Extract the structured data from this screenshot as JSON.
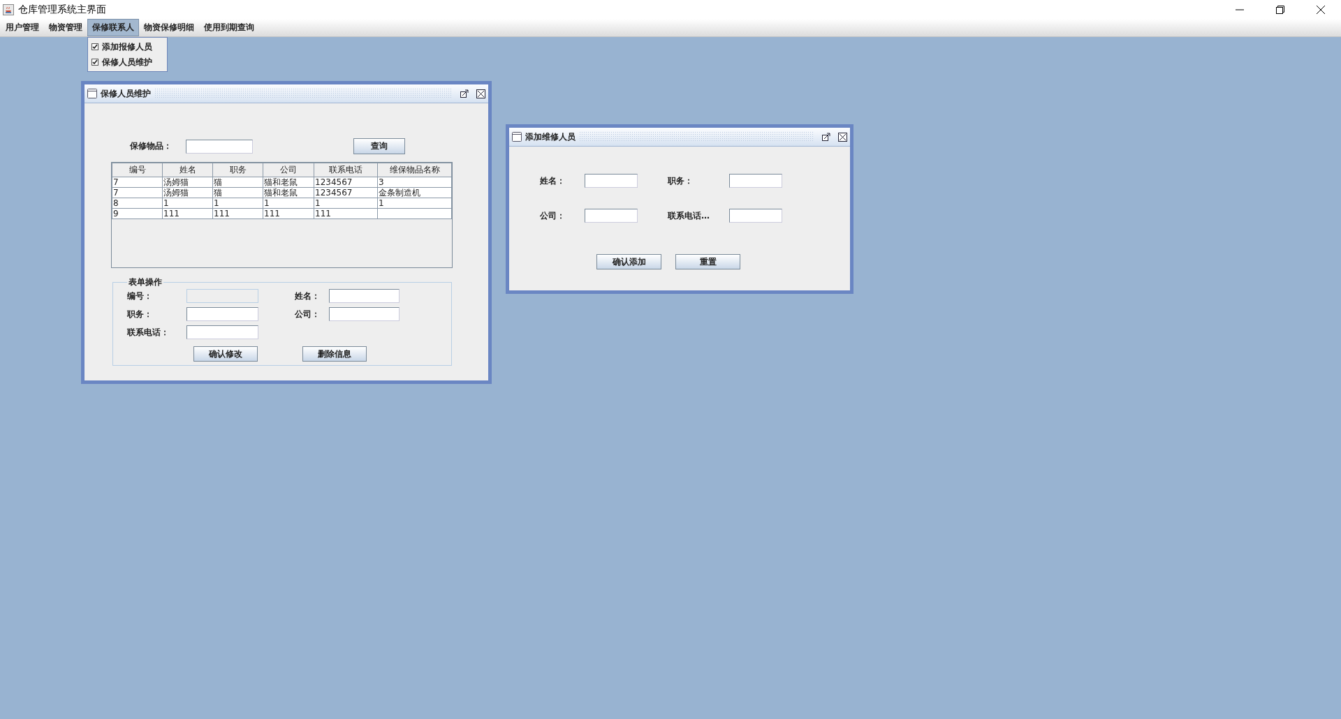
{
  "window": {
    "title": "仓库管理系统主界面"
  },
  "menu_bar": {
    "items": [
      {
        "label": "用户管理",
        "selected": false
      },
      {
        "label": "物资管理",
        "selected": false
      },
      {
        "label": "保修联系人",
        "selected": true
      },
      {
        "label": "物资保修明细",
        "selected": false
      },
      {
        "label": "使用到期查询",
        "selected": false
      }
    ]
  },
  "open_menu": {
    "items": [
      {
        "label": "添加报修人员",
        "checked": true
      },
      {
        "label": "保修人员维护",
        "checked": true
      }
    ]
  },
  "maintenance_frame": {
    "title": "保修人员维护",
    "search": {
      "label": "保修物品："
    },
    "query_button": "查询",
    "table": {
      "columns": [
        "编号",
        "姓名",
        "职务",
        "公司",
        "联系电话",
        "维保物品名称"
      ],
      "rows": [
        [
          "7",
          "汤姆猫",
          "猫",
          "猫和老鼠",
          "1234567",
          "3"
        ],
        [
          "7",
          "汤姆猫",
          "猫",
          "猫和老鼠",
          "1234567",
          "金条制造机"
        ],
        [
          "8",
          "1",
          "1",
          "1",
          "1",
          "1"
        ],
        [
          "9",
          "111",
          "111",
          "111",
          "111",
          ""
        ]
      ]
    },
    "form": {
      "legend": "表单操作",
      "fields": [
        {
          "label": "编号：",
          "disabled": true
        },
        {
          "label": "姓名：",
          "disabled": false
        },
        {
          "label": "职务：",
          "disabled": false
        },
        {
          "label": "公司：",
          "disabled": false
        },
        {
          "label": "联系电话：",
          "disabled": false
        }
      ],
      "buttons": [
        "确认修改",
        "删除信息"
      ]
    }
  },
  "add_frame": {
    "title": "添加维修人员",
    "fields": [
      {
        "label": "姓名："
      },
      {
        "label": "职务："
      },
      {
        "label": "公司："
      },
      {
        "label": "联系电话…"
      }
    ],
    "buttons": [
      "确认添加",
      "重置"
    ]
  }
}
